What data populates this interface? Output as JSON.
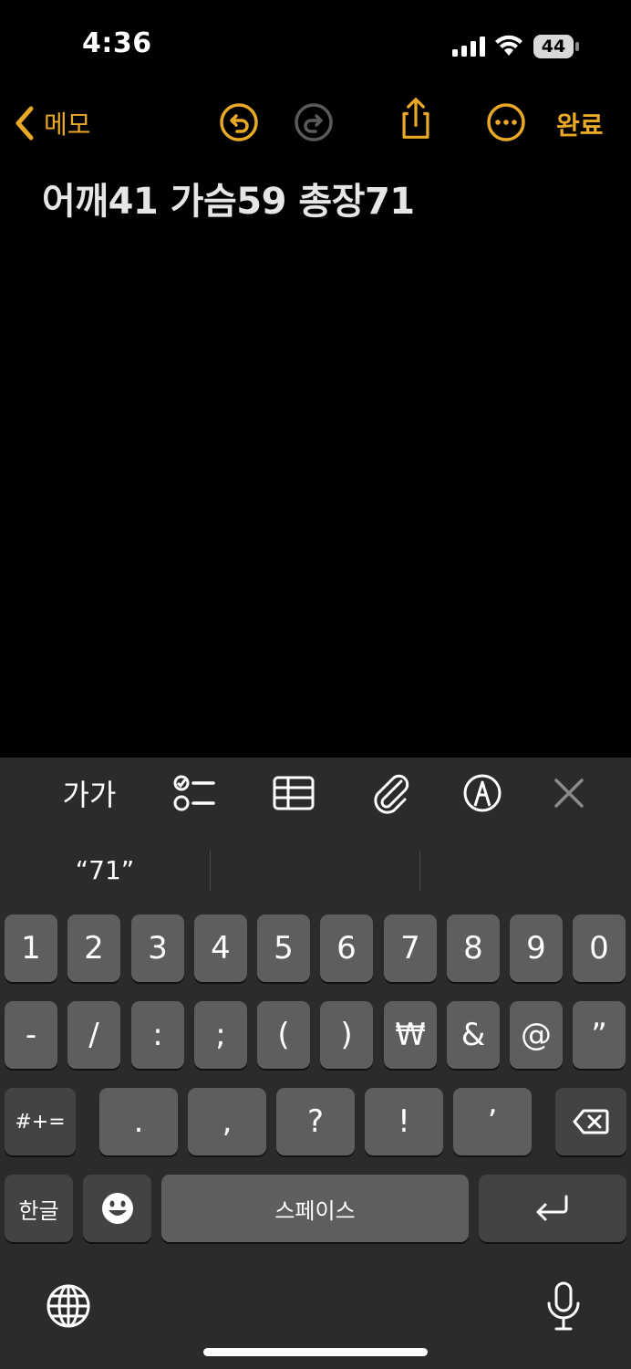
{
  "status_bar": {
    "time": "4:36",
    "battery": "44"
  },
  "nav": {
    "back_label": "메모",
    "done_label": "완료"
  },
  "note": {
    "title": "어깨41 가슴59 총장71"
  },
  "format_toolbar": {
    "text_style_label": "가가"
  },
  "keyboard": {
    "suggestions": [
      "“71”",
      "",
      ""
    ],
    "row1": [
      "1",
      "2",
      "3",
      "4",
      "5",
      "6",
      "7",
      "8",
      "9",
      "0"
    ],
    "row2": [
      "-",
      "/",
      ":",
      ";",
      "(",
      ")",
      "₩",
      "&",
      "@",
      "”"
    ],
    "row3": [
      ".",
      ",",
      "?",
      "!",
      "’"
    ],
    "symbols_key": "#+=",
    "language_key": "한글",
    "space_label": "스페이스"
  },
  "colors": {
    "accent": "#e9a826",
    "keyboard_bg": "#2b2b2b",
    "key": "#5e5e5e",
    "key_dark": "#434343"
  }
}
